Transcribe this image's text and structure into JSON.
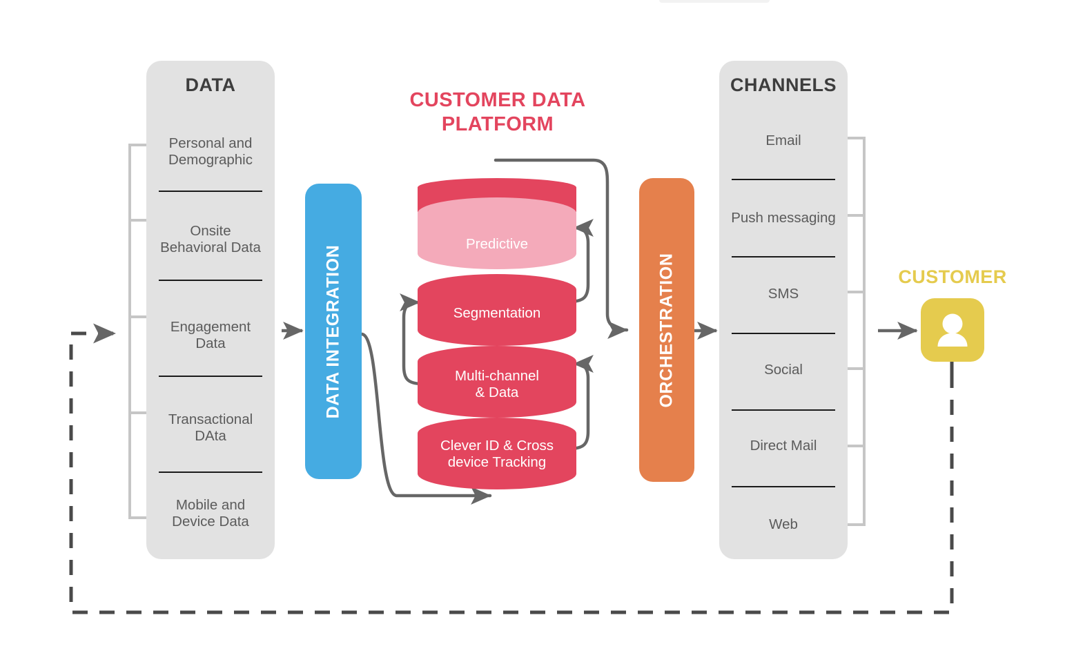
{
  "diagram": {
    "title": "Customer Data Platform architecture flow",
    "colors": {
      "panel_grey": "#e2e2e2",
      "bracket_grey": "#c6c6c6",
      "arrow_grey": "#666666",
      "rule_black": "#1a1a1a",
      "blue": "#45abe2",
      "orange": "#e5804c",
      "pink_dark": "#e3455e",
      "pink_light": "#f4aaba",
      "yellow": "#e5cb4e",
      "text_grey": "#5b5b5b",
      "title_grey": "#3d3d3d"
    }
  },
  "data_panel": {
    "title": "DATA",
    "items": [
      "Personal and Demographic",
      "Onsite Behavioral Data",
      "Engagement Data",
      "Transactional DAta",
      "Mobile and Device Data"
    ],
    "items_lines": [
      [
        "Personal and",
        "Demographic"
      ],
      [
        "Onsite",
        "Behavioral Data"
      ],
      [
        "Engagement",
        "Data"
      ],
      [
        "Transactional",
        "DAta"
      ],
      [
        "Mobile and",
        "Device Data"
      ]
    ]
  },
  "integration_bar": {
    "label": "DATA INTEGRATION",
    "color": "#45abe2"
  },
  "cdp": {
    "title": "CUSTOMER DATA PLATFORM",
    "title_lines": [
      "CUSTOMER DATA",
      "PLATFORM"
    ],
    "title_color": "#e3455e",
    "layers": [
      {
        "label": "Predictive",
        "lines": [
          "Predictive"
        ],
        "color": "#f4aaba"
      },
      {
        "label": "Segmentation",
        "lines": [
          "Segmentation"
        ],
        "color": "#e3455e"
      },
      {
        "label": "Multi-channel & Data",
        "lines": [
          "Multi-channel",
          "& Data"
        ],
        "color": "#e3455e"
      },
      {
        "label": "Clever ID & Cross device Tracking",
        "lines": [
          "Clever ID & Cross",
          "device Tracking"
        ],
        "color": "#e3455e"
      }
    ]
  },
  "orchestration_bar": {
    "label": "ORCHESTRATION",
    "color": "#e5804c"
  },
  "channels_panel": {
    "title": "CHANNELS",
    "items": [
      "Email",
      "Push messaging",
      "SMS",
      "Social",
      "Direct Mail",
      "Web"
    ]
  },
  "customer": {
    "title": "CUSTOMER",
    "icon": "person-icon",
    "color": "#e5cb4e"
  },
  "flow": {
    "main_arrows": [
      "data-to-integration",
      "integration-to-cdp",
      "cdp-to-orchestration",
      "orchestration-to-channels",
      "channels-to-customer"
    ],
    "feedback_loop_label": "customer-feedback-dashed-loop"
  }
}
